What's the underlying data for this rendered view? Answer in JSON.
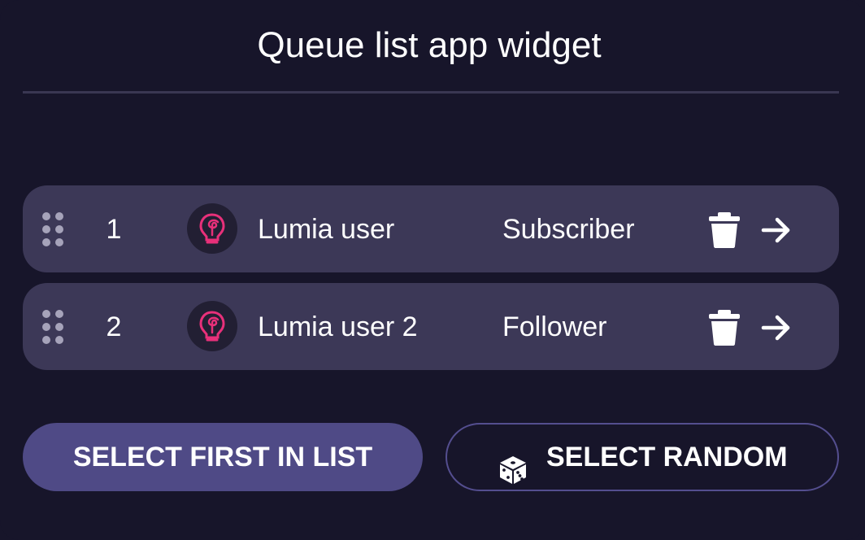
{
  "widget": {
    "title": "Queue list app widget"
  },
  "queue": [
    {
      "position": "1",
      "username": "Lumia user",
      "role": "Subscriber"
    },
    {
      "position": "2",
      "username": "Lumia user 2",
      "role": "Follower"
    }
  ],
  "icons": {
    "drag_handle": "drag-handle-icon",
    "avatar": "lumia-lightbulb-icon",
    "delete": "trash-icon",
    "select": "arrow-right-icon",
    "random": "dice-icon"
  },
  "buttons": {
    "select_first": "SELECT FIRST IN LIST",
    "select_random": "SELECT RANDOM"
  },
  "colors": {
    "background": "#17152a",
    "row": "#3c3857",
    "primary_button": "#4f4a86",
    "outline_button_border": "#544e8f",
    "avatar_accent": "#e8307a"
  }
}
